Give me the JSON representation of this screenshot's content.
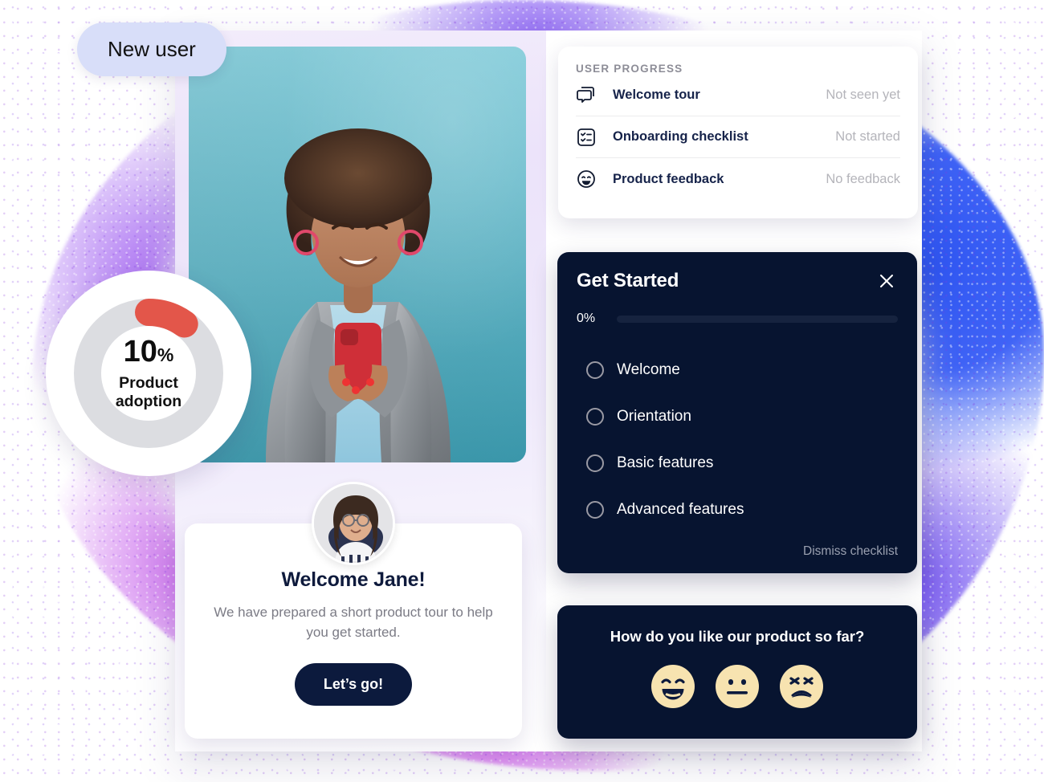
{
  "badge": {
    "label": "New user"
  },
  "gauge": {
    "value": "10",
    "unit": "%",
    "label_line1": "Product",
    "label_line2": "adoption",
    "arc_color": "#e3564a",
    "track_color": "#dcdde1",
    "percent": 10
  },
  "user_progress": {
    "title": "USER PROGRESS",
    "rows": [
      {
        "icon": "chat-bubbles-icon",
        "label": "Welcome tour",
        "status": "Not seen yet"
      },
      {
        "icon": "checklist-square-icon",
        "label": "Onboarding checklist",
        "status": "Not started"
      },
      {
        "icon": "smiley-face-icon",
        "label": "Product feedback",
        "status": "No feedback"
      }
    ]
  },
  "checklist": {
    "title": "Get Started",
    "close_icon": "close-icon",
    "percent_label": "0%",
    "percent_value": 0,
    "items": [
      {
        "label": "Welcome",
        "checked": false
      },
      {
        "label": "Orientation",
        "checked": false
      },
      {
        "label": "Basic features",
        "checked": false
      },
      {
        "label": "Advanced features",
        "checked": false
      }
    ],
    "dismiss_label": "Dismiss checklist",
    "background_color": "#071430"
  },
  "welcome": {
    "avatar": "user-avatar",
    "title": "Welcome Jane!",
    "subtitle": "We have prepared a short product tour to help you get started.",
    "cta_label": "Let’s go!",
    "cta_color": "#0c1a3d"
  },
  "feedback": {
    "question": "How do you like our product so far?",
    "faces": [
      {
        "name": "happy-face-icon",
        "mood": "happy"
      },
      {
        "name": "neutral-face-icon",
        "mood": "neutral"
      },
      {
        "name": "unhappy-face-icon",
        "mood": "unhappy"
      }
    ],
    "face_color": "#f7e3b0",
    "background_color": "#071430"
  },
  "hero": {
    "image": "woman-with-smartphone-photo",
    "background_color": "#5fbccf"
  }
}
